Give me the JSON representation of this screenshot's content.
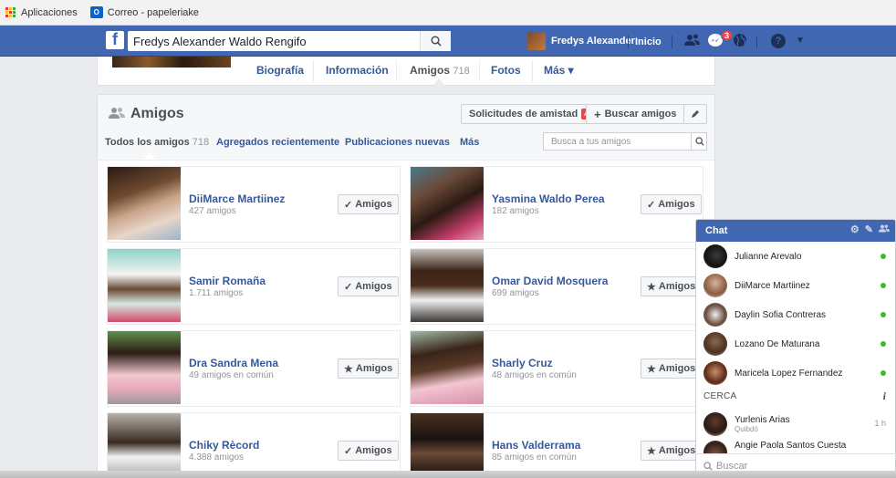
{
  "bookmarks": {
    "apps_label": "Aplicaciones",
    "mail_label": "Correo - papeleriake"
  },
  "topbar": {
    "search_value": "Fredys Alexander Waldo Rengifo",
    "user_name": "Fredys Alexander",
    "home_label": "Inicio",
    "messages_badge": "3"
  },
  "timeline_tabs": [
    {
      "label": "Biografía"
    },
    {
      "label": "Información"
    },
    {
      "label": "Amigos",
      "count": "718"
    },
    {
      "label": "Fotos"
    },
    {
      "label": "Más ▾"
    }
  ],
  "friends": {
    "title": "Amigos",
    "requests_label": "Solicitudes de amistad",
    "requests_badge": "40",
    "find_label": "Buscar amigos",
    "filters": [
      {
        "label": "Todos los amigos",
        "count": "718"
      },
      {
        "label": "Agregados recientemente"
      },
      {
        "label": "Publicaciones nuevas"
      },
      {
        "label": "Más"
      }
    ],
    "search_placeholder": "Busca a tus amigos",
    "cards": [
      {
        "name": "DiiMarce Martiinez",
        "sub": "427 amigos",
        "button": "Amigos",
        "button_icon": "check-icon"
      },
      {
        "name": "Yasmina Waldo Perea",
        "sub": "182 amigos",
        "button": "Amigos",
        "button_icon": "check-icon"
      },
      {
        "name": "Samir Romaña",
        "sub": "1.711 amigos",
        "button": "Amigos",
        "button_icon": "check-icon"
      },
      {
        "name": "Omar David Mosquera",
        "sub": "699 amigos",
        "button": "Amigos",
        "button_icon": "star-icon"
      },
      {
        "name": "Dra Sandra Mena",
        "sub": "49 amigos en común",
        "button": "Amigos",
        "button_icon": "star-icon"
      },
      {
        "name": "Sharly Cruz",
        "sub": "48 amigos en común",
        "button": "Amigos",
        "button_icon": "star-icon"
      },
      {
        "name": "Chiky Rècord",
        "sub": "4.388 amigos",
        "button": "Amigos",
        "button_icon": "check-icon"
      },
      {
        "name": "Hans Valderrama",
        "sub": "85 amigos en común",
        "button": "Amigos",
        "button_icon": "star-icon"
      }
    ]
  },
  "chat": {
    "title": "Chat",
    "contacts": [
      {
        "name": "Julianne Arevalo"
      },
      {
        "name": "DiiMarce Martiinez"
      },
      {
        "name": "Daylin Sofia Contreras"
      },
      {
        "name": "Lozano De Maturana"
      },
      {
        "name": "Maricela Lopez Fernandez"
      }
    ],
    "section_label": "CERCA",
    "nearby": {
      "name": "Yurlenis Arias",
      "location": "Quibdó",
      "time": "1 h"
    },
    "partial_name": "Angie Paola Santos Cuesta",
    "search_placeholder": "Buscar"
  },
  "colors": {
    "brand": "#4267b2",
    "link": "#365899",
    "online": "#42b72a",
    "badge": "#fa3e3e"
  }
}
